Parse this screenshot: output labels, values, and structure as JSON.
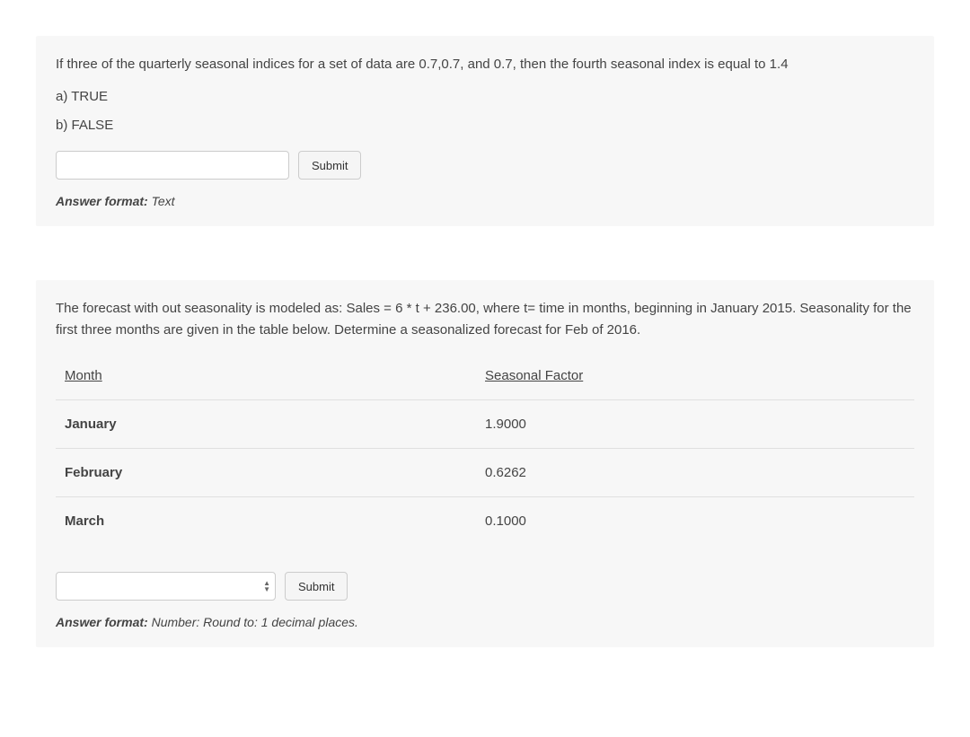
{
  "q1": {
    "text": "If three of the quarterly seasonal indices for a set of data are 0.7,0.7, and 0.7, then the fourth seasonal index is equal to 1.4",
    "options": {
      "a": "a) TRUE",
      "b": "b) FALSE"
    },
    "submit_label": "Submit",
    "format_prefix": "Answer format:",
    "format_value": "Text"
  },
  "q2": {
    "text": "The forecast with out seasonality is modeled as: Sales = 6 * t + 236.00, where t= time in months, beginning in January 2015. Seasonality for the first three months are given in the table below. Determine a seasonalized forecast for Feb of 2016.",
    "table": {
      "headers": {
        "col1": "Month",
        "col2": "Seasonal Factor"
      },
      "rows": [
        {
          "month": "January",
          "factor": "1.9000"
        },
        {
          "month": "February",
          "factor": "0.6262"
        },
        {
          "month": "March",
          "factor": "0.1000"
        }
      ]
    },
    "submit_label": "Submit",
    "format_prefix": "Answer format:",
    "format_value": "Number: Round to: 1 decimal places."
  }
}
